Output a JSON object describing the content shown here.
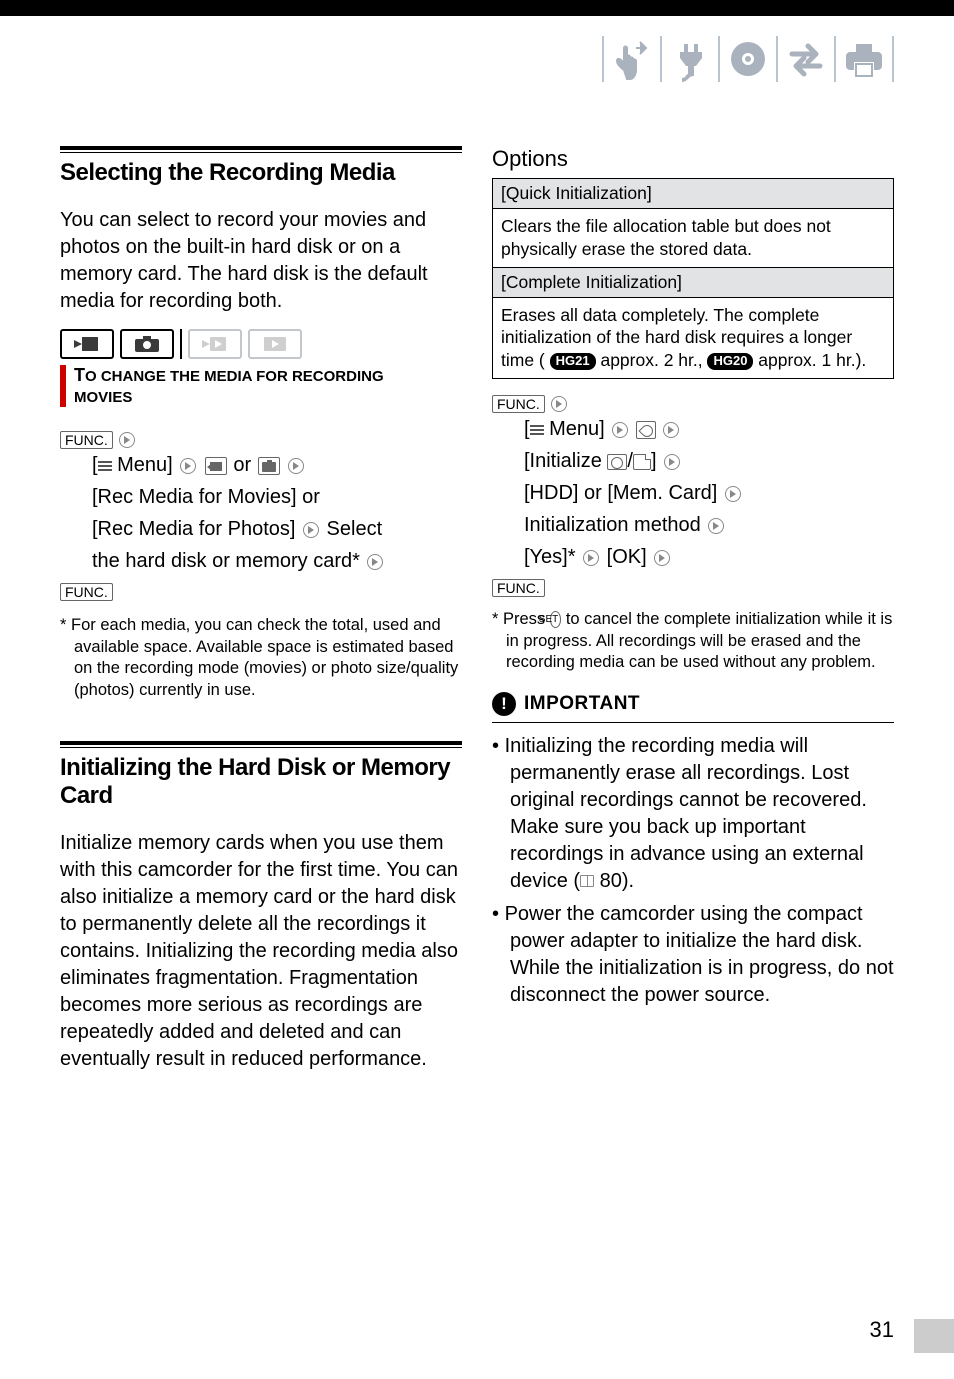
{
  "left": {
    "section1": {
      "title": "Selecting the Recording Media",
      "desc": "You can select to record your movies and photos on the built-in hard disk or on a memory card. The hard disk is the default media for recording both."
    },
    "subhead1": "To change the media for recording movies",
    "func": "FUNC.",
    "steps1": {
      "l1_a": "[",
      "l1_b": " Menu] ",
      "l1_c": " or ",
      "l2": "[Rec Media for Movies] or",
      "l3a": "[Rec Media for Photos] ",
      "l3b": " Select",
      "l4a": "the hard disk or memory card* "
    },
    "foot1": "* For each media, you can check the total, used and available space. Available space is estimated based on the recording mode (movies) or photo size/quality (photos) currently in use.",
    "section2": {
      "title": "Initializing the Hard Disk or Memory Card",
      "desc": "Initialize memory cards when you use them with this camcorder for the first time. You can also initialize a memory card or the hard disk to permanently delete all the recordings it contains. Initializing the recording media also eliminates fragmentation. Fragmentation becomes more serious as recordings are repeatedly added and deleted and can eventually result in reduced performance."
    }
  },
  "right": {
    "options_label": "Options",
    "row1h": "[Quick Initialization]",
    "row1b": "Clears the file allocation table but does not physically erase the stored data.",
    "row2h": "[Complete Initialization]",
    "row2b_a": "Erases all data completely. The complete initialization of the hard disk requires a longer time ( ",
    "hg21": "HG21",
    "row2b_b": " approx. 2 hr., ",
    "hg20": "HG20",
    "row2b_c": " approx. 1 hr.).",
    "steps2": {
      "l1": " Menu] ",
      "l2a": "[Initialize ",
      "l2b": "/",
      "l2c": "] ",
      "l3": "[HDD] or [Mem. Card] ",
      "l4": "Initialization method ",
      "l5a": "[Yes]* ",
      "l5b": " [OK] "
    },
    "foot2_a": "* Press ",
    "set": "SET",
    "foot2_b": " to cancel the complete initialization while it is in progress. All recordings will be erased and the recording media can be used without any problem.",
    "important": "IMPORTANT",
    "bul1a": "Initializing the recording media will permanently erase all recordings. Lost original recordings cannot be recovered. Make sure you back up important recordings in advance using an external device (",
    "bul1b": " 80).",
    "bul2": "Power the camcorder using the compact power adapter to initialize the hard disk. While the initialization is in progress, do not disconnect the power source."
  },
  "page": "31"
}
